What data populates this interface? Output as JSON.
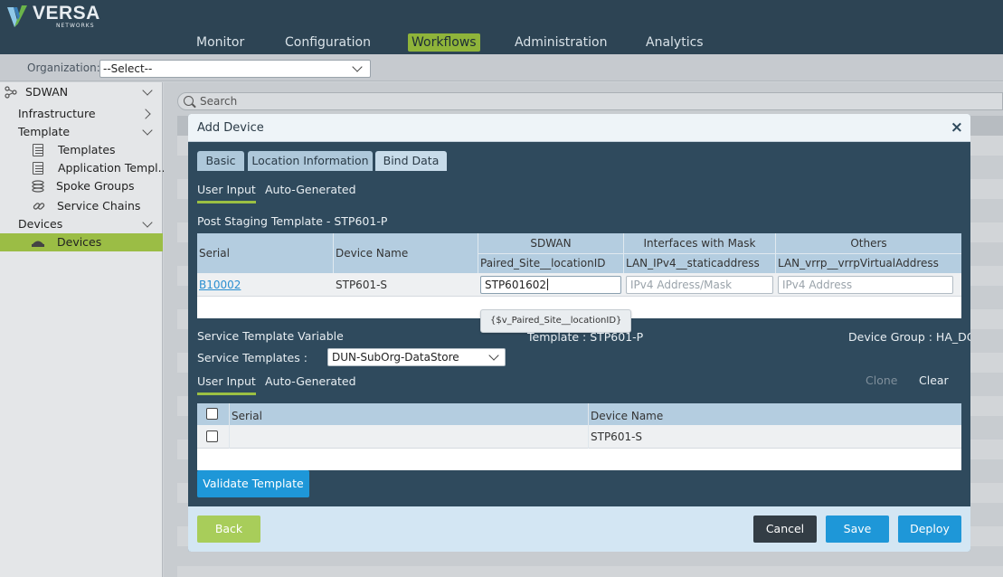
{
  "brand": {
    "name": "VERSA",
    "sub": "NETWORKS"
  },
  "nav": {
    "items": [
      "Monitor",
      "Configuration",
      "Workflows",
      "Administration",
      "Analytics"
    ],
    "active": "Workflows"
  },
  "org": {
    "label": "Organization:",
    "value": "--Select--"
  },
  "sidebar": {
    "section": "SDWAN",
    "items": [
      "Infrastructure",
      "Template",
      "Templates",
      "Application Templ...",
      "Spoke Groups",
      "Service Chains",
      "Devices",
      "Devices"
    ]
  },
  "search": {
    "placeholder": "Search"
  },
  "modal": {
    "title": "Add Device",
    "close": "×",
    "tabs": [
      "Basic",
      "Location Information",
      "Bind Data"
    ],
    "subtabs": [
      "User Input",
      "Auto-Generated"
    ],
    "post_staging_label": "Post Staging Template - STP601-P",
    "table1": {
      "headers": {
        "serial": "Serial",
        "device_name": "Device Name",
        "sdwan": "SDWAN",
        "interfaces": "Interfaces with Mask",
        "others": "Others"
      },
      "subheaders": {
        "sdwan": "Paired_Site__locationID",
        "interfaces": "LAN_IPv4__staticaddress",
        "others": "LAN_vrrp__vrrpVirtualAddress"
      },
      "row": {
        "serial": "B10002",
        "device_name": "STP601-S",
        "sdwan_value": "STP601602",
        "interfaces_placeholder": "IPv4 Address/Mask",
        "others_placeholder": "IPv4 Address"
      }
    },
    "tooltip": "{$v_Paired_Site__locationID}",
    "service_template_variable": "Service Template Variable",
    "template_label": "Template : STP601-P",
    "device_group_label": "Device Group : HA_DG",
    "service_templates_label": "Service Templates :",
    "service_templates_value": "DUN-SubOrg-DataStore",
    "subtabs2": [
      "User Input",
      "Auto-Generated"
    ],
    "clone": "Clone",
    "clear": "Clear",
    "table2": {
      "headers": {
        "serial": "Serial",
        "device_name": "Device Name"
      },
      "row": {
        "serial": "",
        "device_name": "STP601-S"
      }
    },
    "validate_button": "Validate Template",
    "footer": {
      "back": "Back",
      "cancel": "Cancel",
      "save": "Save",
      "deploy": "Deploy"
    }
  },
  "colors": {
    "accent": "#9bc043",
    "primary_button": "#1e97d8",
    "modal_bg": "#2f4a5d",
    "topbar": "#2d4454"
  }
}
